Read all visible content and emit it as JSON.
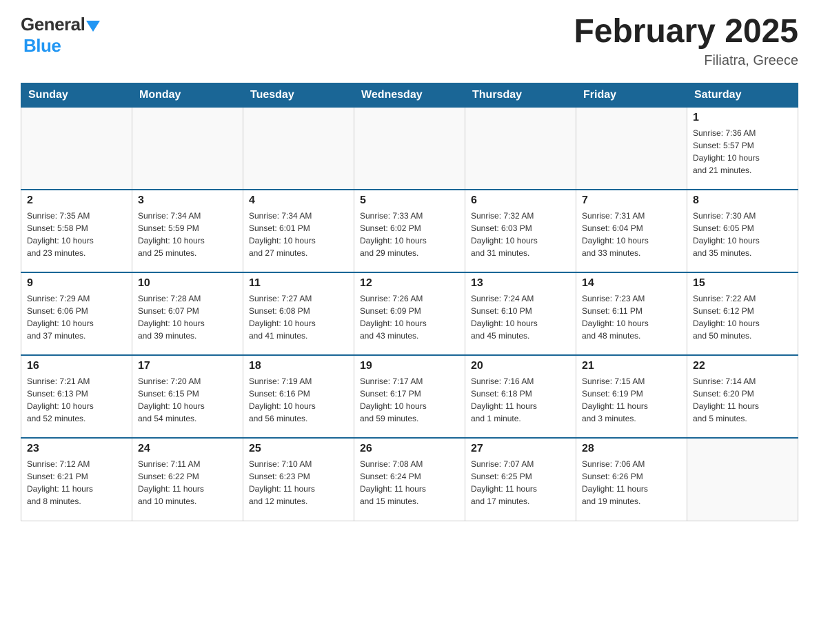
{
  "header": {
    "logo_general": "General",
    "logo_blue": "Blue",
    "title": "February 2025",
    "location": "Filiatra, Greece"
  },
  "calendar": {
    "days_of_week": [
      "Sunday",
      "Monday",
      "Tuesday",
      "Wednesday",
      "Thursday",
      "Friday",
      "Saturday"
    ],
    "weeks": [
      {
        "days": [
          {
            "date": "",
            "info": ""
          },
          {
            "date": "",
            "info": ""
          },
          {
            "date": "",
            "info": ""
          },
          {
            "date": "",
            "info": ""
          },
          {
            "date": "",
            "info": ""
          },
          {
            "date": "",
            "info": ""
          },
          {
            "date": "1",
            "info": "Sunrise: 7:36 AM\nSunset: 5:57 PM\nDaylight: 10 hours\nand 21 minutes."
          }
        ]
      },
      {
        "days": [
          {
            "date": "2",
            "info": "Sunrise: 7:35 AM\nSunset: 5:58 PM\nDaylight: 10 hours\nand 23 minutes."
          },
          {
            "date": "3",
            "info": "Sunrise: 7:34 AM\nSunset: 5:59 PM\nDaylight: 10 hours\nand 25 minutes."
          },
          {
            "date": "4",
            "info": "Sunrise: 7:34 AM\nSunset: 6:01 PM\nDaylight: 10 hours\nand 27 minutes."
          },
          {
            "date": "5",
            "info": "Sunrise: 7:33 AM\nSunset: 6:02 PM\nDaylight: 10 hours\nand 29 minutes."
          },
          {
            "date": "6",
            "info": "Sunrise: 7:32 AM\nSunset: 6:03 PM\nDaylight: 10 hours\nand 31 minutes."
          },
          {
            "date": "7",
            "info": "Sunrise: 7:31 AM\nSunset: 6:04 PM\nDaylight: 10 hours\nand 33 minutes."
          },
          {
            "date": "8",
            "info": "Sunrise: 7:30 AM\nSunset: 6:05 PM\nDaylight: 10 hours\nand 35 minutes."
          }
        ]
      },
      {
        "days": [
          {
            "date": "9",
            "info": "Sunrise: 7:29 AM\nSunset: 6:06 PM\nDaylight: 10 hours\nand 37 minutes."
          },
          {
            "date": "10",
            "info": "Sunrise: 7:28 AM\nSunset: 6:07 PM\nDaylight: 10 hours\nand 39 minutes."
          },
          {
            "date": "11",
            "info": "Sunrise: 7:27 AM\nSunset: 6:08 PM\nDaylight: 10 hours\nand 41 minutes."
          },
          {
            "date": "12",
            "info": "Sunrise: 7:26 AM\nSunset: 6:09 PM\nDaylight: 10 hours\nand 43 minutes."
          },
          {
            "date": "13",
            "info": "Sunrise: 7:24 AM\nSunset: 6:10 PM\nDaylight: 10 hours\nand 45 minutes."
          },
          {
            "date": "14",
            "info": "Sunrise: 7:23 AM\nSunset: 6:11 PM\nDaylight: 10 hours\nand 48 minutes."
          },
          {
            "date": "15",
            "info": "Sunrise: 7:22 AM\nSunset: 6:12 PM\nDaylight: 10 hours\nand 50 minutes."
          }
        ]
      },
      {
        "days": [
          {
            "date": "16",
            "info": "Sunrise: 7:21 AM\nSunset: 6:13 PM\nDaylight: 10 hours\nand 52 minutes."
          },
          {
            "date": "17",
            "info": "Sunrise: 7:20 AM\nSunset: 6:15 PM\nDaylight: 10 hours\nand 54 minutes."
          },
          {
            "date": "18",
            "info": "Sunrise: 7:19 AM\nSunset: 6:16 PM\nDaylight: 10 hours\nand 56 minutes."
          },
          {
            "date": "19",
            "info": "Sunrise: 7:17 AM\nSunset: 6:17 PM\nDaylight: 10 hours\nand 59 minutes."
          },
          {
            "date": "20",
            "info": "Sunrise: 7:16 AM\nSunset: 6:18 PM\nDaylight: 11 hours\nand 1 minute."
          },
          {
            "date": "21",
            "info": "Sunrise: 7:15 AM\nSunset: 6:19 PM\nDaylight: 11 hours\nand 3 minutes."
          },
          {
            "date": "22",
            "info": "Sunrise: 7:14 AM\nSunset: 6:20 PM\nDaylight: 11 hours\nand 5 minutes."
          }
        ]
      },
      {
        "days": [
          {
            "date": "23",
            "info": "Sunrise: 7:12 AM\nSunset: 6:21 PM\nDaylight: 11 hours\nand 8 minutes."
          },
          {
            "date": "24",
            "info": "Sunrise: 7:11 AM\nSunset: 6:22 PM\nDaylight: 11 hours\nand 10 minutes."
          },
          {
            "date": "25",
            "info": "Sunrise: 7:10 AM\nSunset: 6:23 PM\nDaylight: 11 hours\nand 12 minutes."
          },
          {
            "date": "26",
            "info": "Sunrise: 7:08 AM\nSunset: 6:24 PM\nDaylight: 11 hours\nand 15 minutes."
          },
          {
            "date": "27",
            "info": "Sunrise: 7:07 AM\nSunset: 6:25 PM\nDaylight: 11 hours\nand 17 minutes."
          },
          {
            "date": "28",
            "info": "Sunrise: 7:06 AM\nSunset: 6:26 PM\nDaylight: 11 hours\nand 19 minutes."
          },
          {
            "date": "",
            "info": ""
          }
        ]
      }
    ]
  }
}
